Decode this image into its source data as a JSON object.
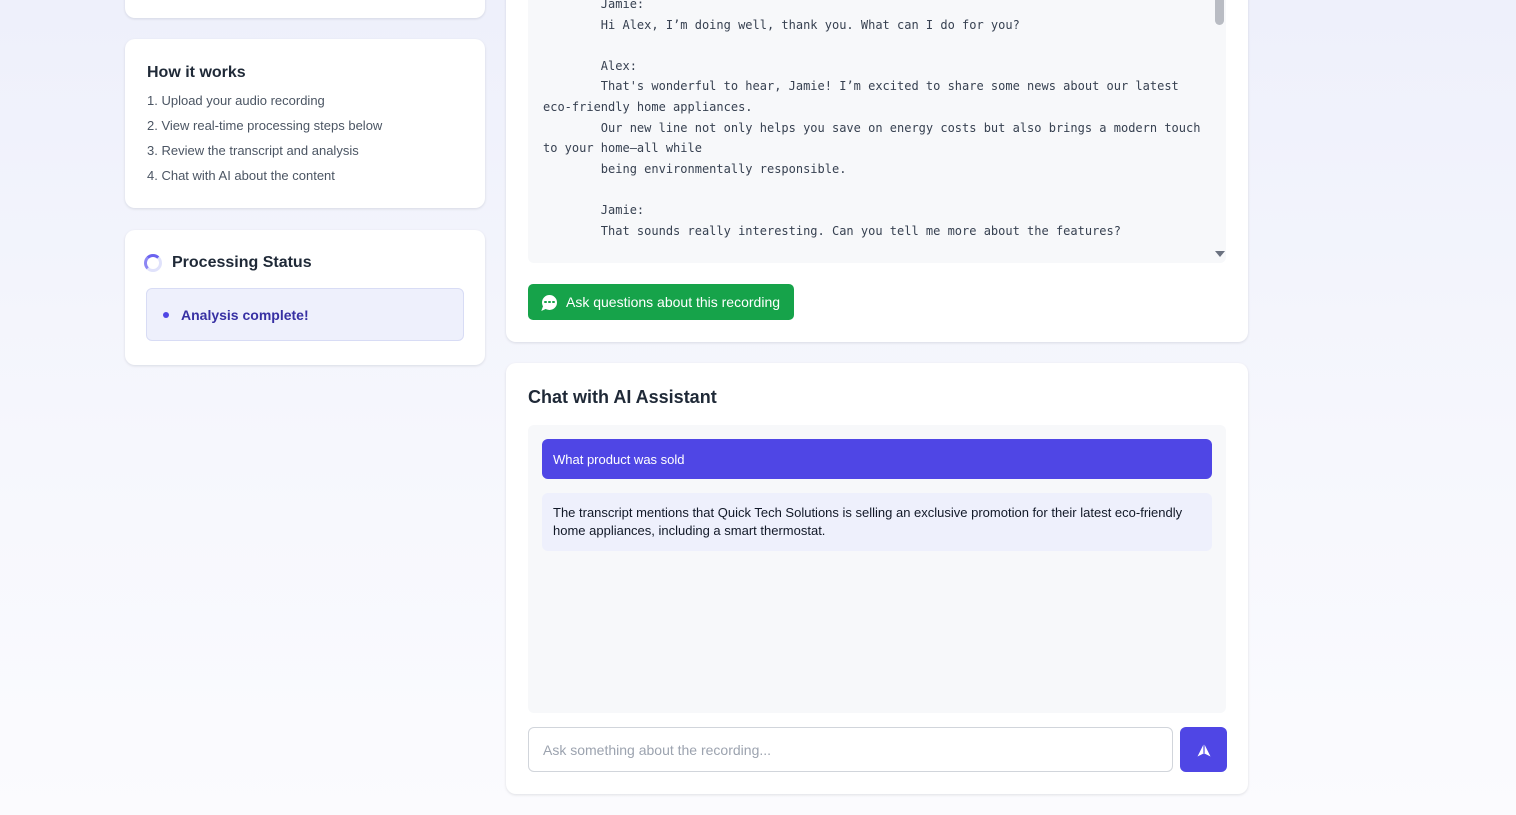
{
  "how_it_works": {
    "title": "How it works",
    "steps": [
      "1. Upload your audio recording",
      "2. View real-time processing steps below",
      "3. Review the transcript and analysis",
      "4. Chat with AI about the content"
    ]
  },
  "processing_status": {
    "title": "Processing Status",
    "message": "Analysis complete!"
  },
  "transcript": {
    "text": "        Jamie:\n        Hi Alex, I’m doing well, thank you. What can I do for you?\n\n        Alex:\n        That's wonderful to hear, Jamie! I’m excited to share some news about our latest eco-friendly home appliances.\n        Our new line not only helps you save on energy costs but also brings a modern touch to your home—all while\n        being environmentally responsible.\n\n        Jamie:\n        That sounds really interesting. Can you tell me more about the features?",
    "ask_button_label": "Ask questions about this recording"
  },
  "chat": {
    "title": "Chat with AI Assistant",
    "messages": [
      {
        "role": "user",
        "text": "What product was sold"
      },
      {
        "role": "assistant",
        "text": " The transcript mentions that Quick Tech Solutions is selling an exclusive promotion for their latest eco-friendly home appliances, including a smart thermostat."
      }
    ],
    "input_placeholder": "Ask something about the recording...",
    "send_icon": "send-arrow-icon"
  },
  "colors": {
    "accent": "#4f46e5",
    "success": "#16a34a",
    "status_bg": "#eef0fc"
  }
}
